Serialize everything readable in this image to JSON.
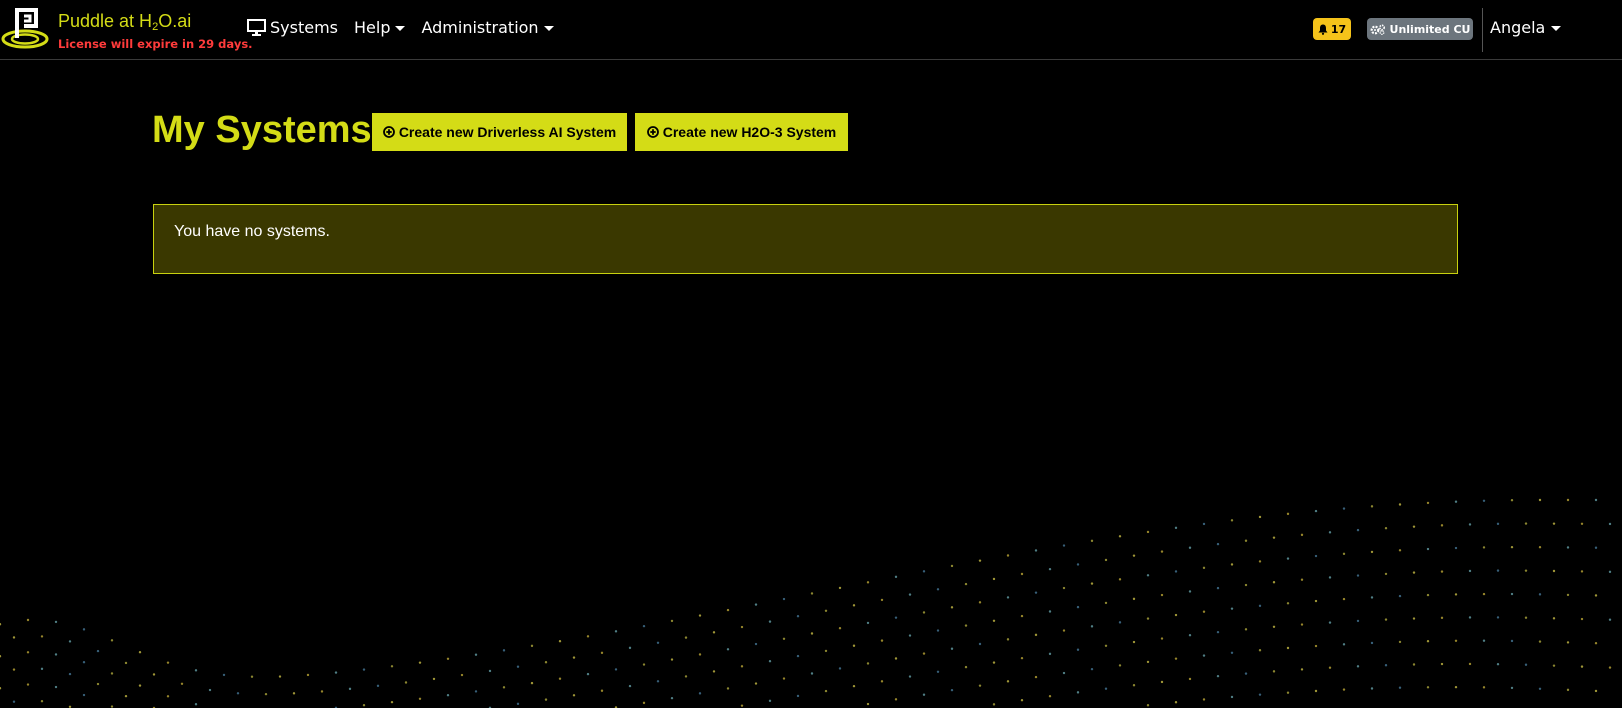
{
  "brand": {
    "name_prefix": "Puddle at H",
    "name_sub": "2",
    "name_suffix": "O.ai",
    "license_notice": "License will expire in 29 days."
  },
  "nav": {
    "systems": "Systems",
    "help": "Help",
    "administration": "Administration"
  },
  "notifications": {
    "count": "17"
  },
  "compute_units": {
    "label": "Unlimited CU"
  },
  "user": {
    "name": "Angela"
  },
  "page": {
    "title": "My Systems",
    "create_dai_label": "Create new Driverless AI System",
    "create_h2o3_label": "Create new H2O-3 System",
    "empty_message": "You have no systems."
  },
  "colors": {
    "accent": "#d4dc16",
    "warning_text": "#ff3b3b",
    "badge_warning": "#f5c31a",
    "badge_secondary": "#6c757d",
    "alert_bg": "#3a3800"
  },
  "icons": {
    "logo": "puddle-logo",
    "systems": "monitor-icon",
    "notifications": "bell-icon",
    "compute": "gears-icon",
    "create": "plus-circle-icon"
  }
}
